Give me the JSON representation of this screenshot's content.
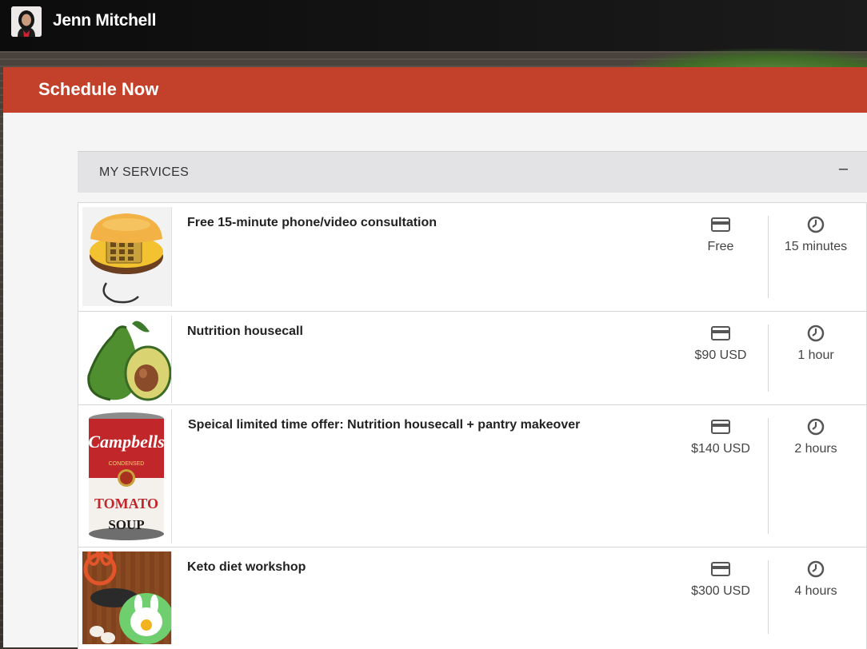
{
  "header": {
    "user_name": "Jenn Mitchell"
  },
  "panel": {
    "title": "Schedule Now"
  },
  "services_section": {
    "title": "MY SERVICES",
    "collapse_label": "–"
  },
  "services": [
    {
      "name": "Free 15-minute phone/video consultation",
      "price": "Free",
      "duration": "15 minutes",
      "image": "burger-phone"
    },
    {
      "name": "Nutrition housecall",
      "price": "$90 USD",
      "duration": "1 hour",
      "image": "avocado"
    },
    {
      "name": "Speical limited time offer: Nutrition housecall + pantry makeover",
      "price": "$140 USD",
      "duration": "2 hours",
      "image": "campbells-tomato-soup",
      "image_text": {
        "brand": "Campbells",
        "condensed": "CONDENSED",
        "variety": "TOMATO",
        "type": "SOUP"
      }
    },
    {
      "name": "Keto diet workshop",
      "price": "$300 USD",
      "duration": "4 hours",
      "image": "egg-bunny"
    }
  ],
  "icons": {
    "price": "credit-card-icon",
    "duration": "clock-icon"
  },
  "colors": {
    "accent": "#c3412a",
    "header_bg": "#111111",
    "panel_bg": "#f5f5f6",
    "section_bar": "#e3e3e5"
  }
}
